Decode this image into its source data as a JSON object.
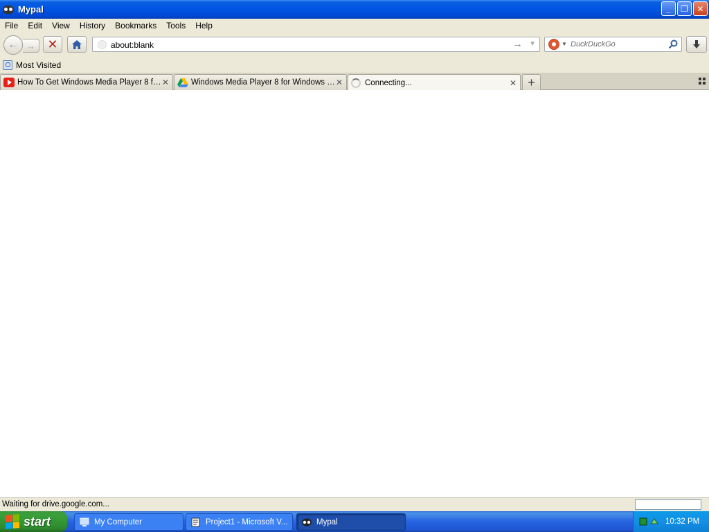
{
  "window": {
    "title": "Mypal",
    "minimize_label": "_",
    "restore_label": "❐",
    "close_label": "✕"
  },
  "menu": {
    "items": [
      "File",
      "Edit",
      "View",
      "History",
      "Bookmarks",
      "Tools",
      "Help"
    ]
  },
  "navigation": {
    "back_icon": "back-arrow-icon",
    "forward_icon": "forward-arrow-icon",
    "stop_icon": "stop-icon",
    "home_icon": "home-icon",
    "url": "about:blank",
    "search_placeholder": "DuckDuckGo",
    "download_icon": "download-icon"
  },
  "bookmarks": {
    "items": [
      "Most Visited"
    ]
  },
  "tabs": [
    {
      "label": "How To Get Windows Media Player 8 for ...",
      "favicon": "youtube-icon"
    },
    {
      "label": "Windows Media Player 8 for Windows 7 a...",
      "favicon": "google-drive-icon"
    },
    {
      "label": "Connecting...",
      "favicon": "loading-spinner-icon"
    }
  ],
  "status": {
    "text": "Waiting for drive.google.com..."
  },
  "taskbar": {
    "start_label": "start",
    "tasks": [
      {
        "label": "My Computer"
      },
      {
        "label": "Project1 - Microsoft V..."
      },
      {
        "label": "Mypal"
      }
    ],
    "clock": "10:32 PM"
  },
  "colors": {
    "titlebar": "#0054e3",
    "chrome": "#ece9d8",
    "taskbar": "#2663e0",
    "start": "#3a9f3a"
  }
}
